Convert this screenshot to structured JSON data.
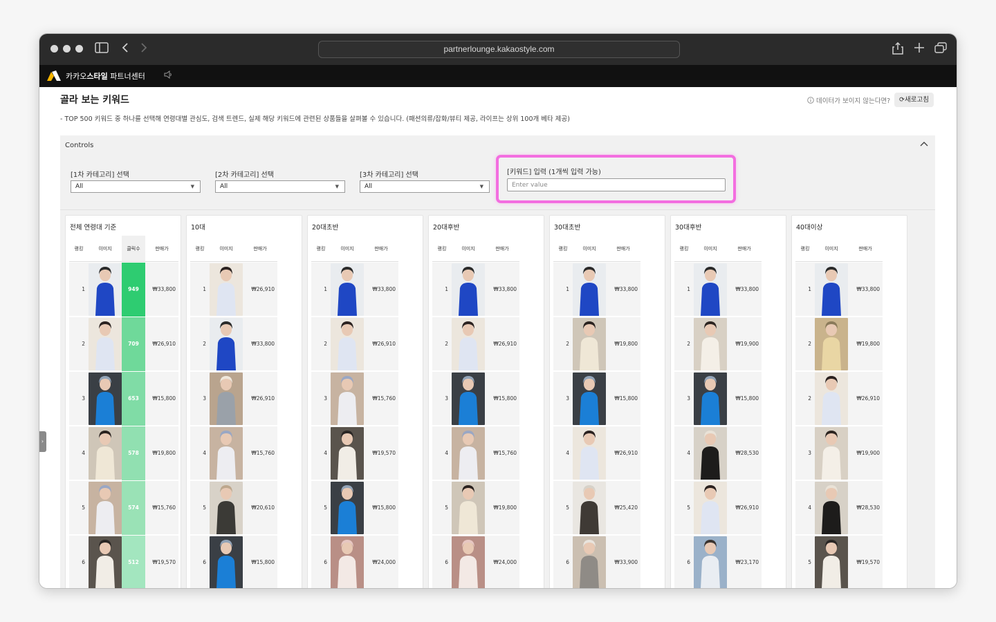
{
  "browser": {
    "url": "partnerlounge.kakaostyle.com"
  },
  "app": {
    "name_prefix": "카카오",
    "name_bold": "스타일",
    "name_suffix": " 파트너센터"
  },
  "page": {
    "title": "골라 보는 키워드",
    "description": "- TOP 500 키워드 중 하나를 선택해 연령대별 관심도, 검색 트렌드, 실제 해당 키워드에 관련된 상품들을 살펴볼 수 있습니다. (패션의류/잡화/뷰티 제공, 라이프는 상위 100개 베타 제공)",
    "no_data_link": "데이터가 보이지 않는다면?",
    "refresh_label": "새로고침"
  },
  "controls": {
    "title": "Controls",
    "cat1_label": "[1차 카테고리] 선택",
    "cat1_value": "All",
    "cat2_label": "[2차 카테고리] 선택",
    "cat2_value": "All",
    "cat3_label": "[3차 카테고리] 선택",
    "cat3_value": "All",
    "keyword_label": "[키워드] 입력 (1개씩 입력 가능)",
    "keyword_placeholder": "Enter value"
  },
  "columns": {
    "rank": "랭킹",
    "image": "이미지",
    "clicks": "클릭수",
    "price": "판매가"
  },
  "colors": {
    "click_high": "#2ecc71",
    "click_low": "#a3e6bf",
    "highlight": "#f36ee0"
  },
  "panels": [
    {
      "title": "전체 연령대 기준",
      "has_clicks": true,
      "rows": [
        {
          "rank": "1",
          "clicks": "949",
          "price": "₩33,800",
          "img": "blue-cardigan"
        },
        {
          "rank": "2",
          "clicks": "709",
          "price": "₩26,910",
          "img": "white-blouse"
        },
        {
          "rank": "3",
          "clicks": "653",
          "price": "₩15,800",
          "img": "blue-top"
        },
        {
          "rank": "4",
          "clicks": "578",
          "price": "₩19,800",
          "img": "beige-dress"
        },
        {
          "rank": "5",
          "clicks": "574",
          "price": "₩15,760",
          "img": "white-cami"
        },
        {
          "rank": "6",
          "clicks": "512",
          "price": "₩19,570",
          "img": "sheer-cardigan"
        }
      ]
    },
    {
      "title": "10대",
      "has_clicks": false,
      "rows": [
        {
          "rank": "1",
          "price": "₩26,910",
          "img": "white-blouse"
        },
        {
          "rank": "2",
          "price": "₩33,800",
          "img": "blue-cardigan"
        },
        {
          "rank": "3",
          "price": "₩26,910",
          "img": "grey-knit"
        },
        {
          "rank": "4",
          "price": "₩15,760",
          "img": "white-cami"
        },
        {
          "rank": "5",
          "price": "₩20,610",
          "img": "dark-shirt"
        },
        {
          "rank": "6",
          "price": "₩15,800",
          "img": "blue-top"
        }
      ]
    },
    {
      "title": "20대초반",
      "has_clicks": false,
      "rows": [
        {
          "rank": "1",
          "price": "₩33,800",
          "img": "blue-cardigan"
        },
        {
          "rank": "2",
          "price": "₩26,910",
          "img": "white-blouse"
        },
        {
          "rank": "3",
          "price": "₩15,760",
          "img": "white-cami"
        },
        {
          "rank": "4",
          "price": "₩19,570",
          "img": "sheer-cardigan"
        },
        {
          "rank": "5",
          "price": "₩15,800",
          "img": "blue-top"
        },
        {
          "rank": "6",
          "price": "₩24,000",
          "img": "pink-top"
        }
      ]
    },
    {
      "title": "20대후반",
      "has_clicks": false,
      "rows": [
        {
          "rank": "1",
          "price": "₩33,800",
          "img": "blue-cardigan"
        },
        {
          "rank": "2",
          "price": "₩26,910",
          "img": "white-blouse"
        },
        {
          "rank": "3",
          "price": "₩15,800",
          "img": "blue-top"
        },
        {
          "rank": "4",
          "price": "₩15,760",
          "img": "white-cami"
        },
        {
          "rank": "5",
          "price": "₩19,800",
          "img": "beige-dress"
        },
        {
          "rank": "6",
          "price": "₩24,000",
          "img": "pink-top"
        }
      ]
    },
    {
      "title": "30대초반",
      "has_clicks": false,
      "rows": [
        {
          "rank": "1",
          "price": "₩33,800",
          "img": "blue-cardigan"
        },
        {
          "rank": "2",
          "price": "₩19,800",
          "img": "beige-dress"
        },
        {
          "rank": "3",
          "price": "₩15,800",
          "img": "blue-top"
        },
        {
          "rank": "4",
          "price": "₩26,910",
          "img": "white-blouse"
        },
        {
          "rank": "5",
          "price": "₩25,420",
          "img": "mirror-outfit"
        },
        {
          "rank": "6",
          "price": "₩33,900",
          "img": "grey-set"
        }
      ]
    },
    {
      "title": "30대후반",
      "has_clicks": false,
      "rows": [
        {
          "rank": "1",
          "price": "₩33,800",
          "img": "blue-cardigan"
        },
        {
          "rank": "2",
          "price": "₩19,900",
          "img": "ivory-knit"
        },
        {
          "rank": "3",
          "price": "₩15,800",
          "img": "blue-top"
        },
        {
          "rank": "4",
          "price": "₩28,530",
          "img": "black-cardigan"
        },
        {
          "rank": "5",
          "price": "₩26,910",
          "img": "white-blouse"
        },
        {
          "rank": "6",
          "price": "₩23,170",
          "img": "beach-dress"
        }
      ]
    },
    {
      "title": "40대이상",
      "has_clicks": false,
      "rows": [
        {
          "rank": "1",
          "price": "₩33,800",
          "img": "blue-cardigan"
        },
        {
          "rank": "2",
          "price": "₩19,800",
          "img": "floral-outfit"
        },
        {
          "rank": "2",
          "price": "₩26,910",
          "img": "white-blouse"
        },
        {
          "rank": "3",
          "price": "₩19,900",
          "img": "ivory-knit"
        },
        {
          "rank": "4",
          "price": "₩28,530",
          "img": "black-cardigan"
        },
        {
          "rank": "5",
          "price": "₩19,570",
          "img": "sheer-cardigan"
        }
      ]
    }
  ]
}
